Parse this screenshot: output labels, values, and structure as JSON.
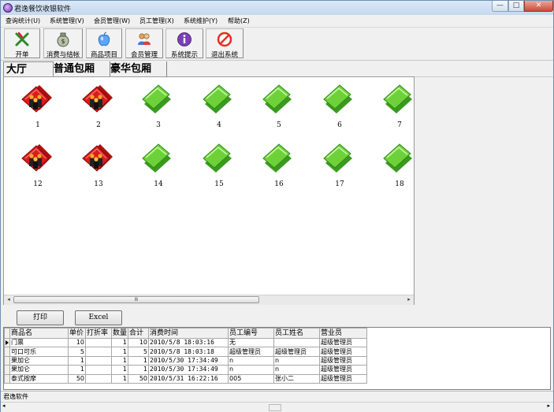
{
  "window": {
    "title": "君逸餐饮收银软件",
    "min_label": "—",
    "max_label": "□",
    "close_label": "✕"
  },
  "menu": [
    {
      "label": "查询统计(U)"
    },
    {
      "label": "系统管理(V)"
    },
    {
      "label": "会员管理(W)"
    },
    {
      "label": "员工管理(X)"
    },
    {
      "label": "系统维护(Y)"
    },
    {
      "label": "帮助(Z)"
    }
  ],
  "toolbar": [
    {
      "label": "开单",
      "icon": "open-order-icon"
    },
    {
      "label": "消费与结帐",
      "icon": "money-bag-icon"
    },
    {
      "label": "商品项目",
      "icon": "product-icon"
    },
    {
      "label": "会员管理",
      "icon": "members-icon"
    },
    {
      "label": "系统提示",
      "icon": "info-icon"
    },
    {
      "label": "退出系统",
      "icon": "exit-icon"
    }
  ],
  "tabs": [
    {
      "label": "大厅"
    },
    {
      "label": "普通包厢"
    },
    {
      "label": "豪华包厢"
    }
  ],
  "rooms": [
    {
      "number": "1",
      "status": "occupied"
    },
    {
      "number": "2",
      "status": "occupied"
    },
    {
      "number": "3",
      "status": "free"
    },
    {
      "number": "4",
      "status": "free"
    },
    {
      "number": "5",
      "status": "free"
    },
    {
      "number": "6",
      "status": "free"
    },
    {
      "number": "7",
      "status": "free"
    },
    {
      "number": "12",
      "status": "occupied"
    },
    {
      "number": "13",
      "status": "occupied"
    },
    {
      "number": "14",
      "status": "free"
    },
    {
      "number": "15",
      "status": "free"
    },
    {
      "number": "16",
      "status": "free"
    },
    {
      "number": "17",
      "status": "free"
    },
    {
      "number": "18",
      "status": "free"
    }
  ],
  "scroll_thumb": "Ⅲ",
  "actions": {
    "print": "打印",
    "excel": "Excel"
  },
  "grid": {
    "columns": [
      "商品名",
      "单价",
      "打折率",
      "数量",
      "合计",
      "消费时间",
      "员工编号",
      "员工姓名",
      "营业员"
    ],
    "rows": [
      [
        "门票",
        "10",
        "",
        "1",
        "10",
        "2010/5/8 18:03:16",
        "无",
        "",
        "超级管理员"
      ],
      [
        "可口可乐",
        "5",
        "",
        "1",
        "5",
        "2010/5/8 18:03:18",
        "超级管理员",
        "超级管理员",
        "超级管理员"
      ],
      [
        "果加仑",
        "1",
        "",
        "1",
        "1",
        "2010/5/30 17:34:49",
        "n",
        "n",
        "超级管理员"
      ],
      [
        "果加仑",
        "1",
        "",
        "1",
        "1",
        "2010/5/30 17:34:49",
        "n",
        "n",
        "超级管理员"
      ],
      [
        "泰式按摩",
        "50",
        "",
        "1",
        "50",
        "2010/5/31 16:22:16",
        "005",
        "张小二",
        "超级管理员"
      ]
    ]
  },
  "status": {
    "text": "君逸软件"
  },
  "colors": {
    "occupied": "#d91c1c",
    "free": "#6fd13a",
    "title_bg": "#c6d9ef"
  }
}
